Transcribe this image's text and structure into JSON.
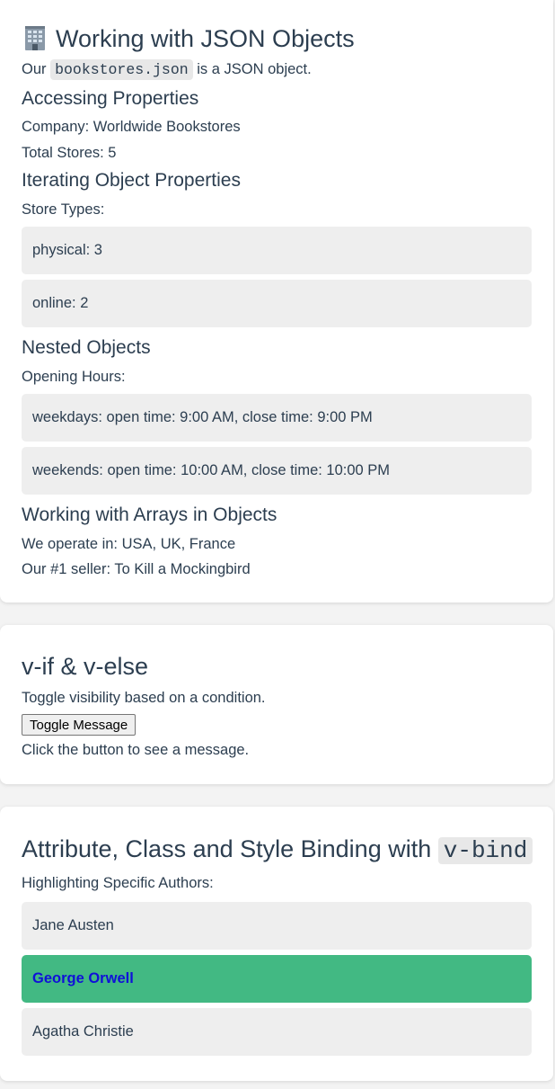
{
  "json_section": {
    "title": "Working with JSON Objects",
    "intro_prefix": "Our",
    "intro_code": "bookstores.json",
    "intro_suffix": "is a JSON object.",
    "accessing_heading": "Accessing Properties",
    "company_line": "Company: Worldwide Bookstores",
    "stores_line": "Total Stores: 5",
    "iterating_heading": "Iterating Object Properties",
    "store_types_label": "Store Types:",
    "store_types": [
      "physical: 3",
      "online: 2"
    ],
    "nested_heading": "Nested Objects",
    "opening_hours_label": "Opening Hours:",
    "opening_hours": [
      "weekdays: open time: 9:00 AM, close time: 9:00 PM",
      "weekends: open time: 10:00 AM, close time: 10:00 PM"
    ],
    "arrays_heading": "Working with Arrays in Objects",
    "countries_line": "We operate in: USA, UK, France",
    "seller_line": "Our #1 seller: To Kill a Mockingbird"
  },
  "vif_section": {
    "title": "v-if & v-else",
    "description": "Toggle visibility based on a condition.",
    "button_label": "Toggle Message",
    "message": "Click the button to see a message."
  },
  "bind_section": {
    "title_prefix": "Attribute, Class and Style Binding with",
    "title_code": "v-bind",
    "subtitle": "Highlighting Specific Authors:",
    "authors": [
      "Jane Austen",
      "George Orwell",
      "Agatha Christie"
    ]
  },
  "icons": {
    "title_icon": "office-building-icon"
  },
  "colors": {
    "highlight_bg": "#42b983",
    "highlight_text": "#1010d8",
    "row_bg": "#eeeeee"
  }
}
